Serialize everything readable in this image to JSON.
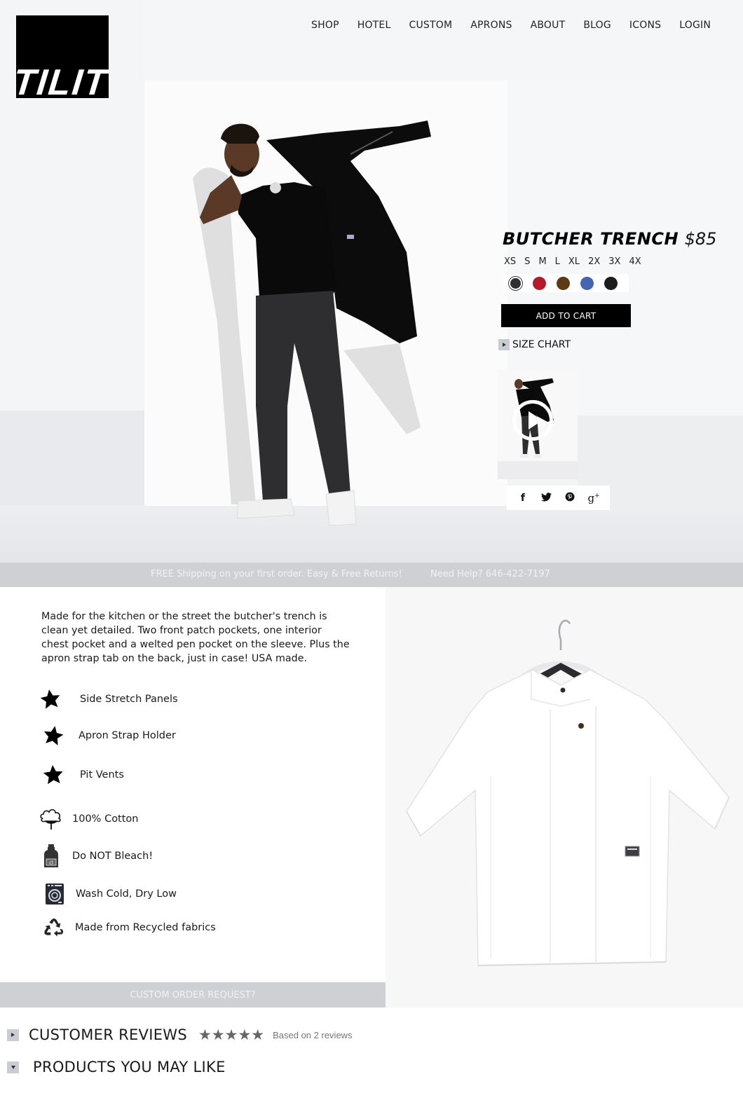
{
  "brand": {
    "logo_text": "TILIT"
  },
  "nav": {
    "items": [
      {
        "label": "SHOP"
      },
      {
        "label": "HOTEL"
      },
      {
        "label": "CUSTOM"
      },
      {
        "label": "APRONS"
      },
      {
        "label": "ABOUT"
      },
      {
        "label": "BLOG"
      },
      {
        "label": "ICONS"
      },
      {
        "label": "LOGIN"
      }
    ]
  },
  "product": {
    "name": "BUTCHER TRENCH",
    "price": "$85",
    "sizes": [
      "XS",
      "S",
      "M",
      "L",
      "XL",
      "2X",
      "3X",
      "4X"
    ],
    "colors": [
      {
        "name": "charcoal",
        "hex": "#2e2f33",
        "selected": true
      },
      {
        "name": "red",
        "hex": "#b5192b",
        "selected": false
      },
      {
        "name": "brown",
        "hex": "#5e3a14",
        "selected": false
      },
      {
        "name": "blue",
        "hex": "#4466b0",
        "selected": false
      },
      {
        "name": "black",
        "hex": "#1d1d1f",
        "selected": false
      }
    ],
    "add_to_cart_label": "ADD TO CART",
    "size_chart_label": "SIZE CHART",
    "video_thumbnail": {
      "icon": "play-icon"
    },
    "share": [
      {
        "network": "facebook",
        "glyph": "f"
      },
      {
        "network": "twitter",
        "glyph": "🐦"
      },
      {
        "network": "pinterest",
        "glyph": "℗"
      },
      {
        "network": "google-plus",
        "glyph": "g+"
      }
    ]
  },
  "shipping_bar": {
    "promo": "FREE Shipping on your first order. Easy & Free Returns!",
    "help": "Need Help? 646-422-7197"
  },
  "details": {
    "description": "Made for the kitchen or the street the butcher's trench is clean yet detailed. Two front patch pockets, one interior chest pocket and a welted pen pocket on the sleeve. Plus the apron strap tab on the back, just in case! USA made.",
    "features": [
      {
        "icon": "star-icon",
        "label": "Side Stretch Panels"
      },
      {
        "icon": "star-icon",
        "label": "Apron Strap Holder"
      },
      {
        "icon": "star-icon",
        "label": "Pit Vents"
      },
      {
        "icon": "cotton-icon",
        "label": "100% Cotton"
      },
      {
        "icon": "bleach-bottle-icon",
        "label": "Do NOT Bleach!"
      },
      {
        "icon": "washing-machine-icon",
        "label": "Wash Cold, Dry Low"
      },
      {
        "icon": "recycle-icon",
        "label": "Made from Recycled fabrics"
      }
    ],
    "custom_order_label": "CUSTOM ORDER REQUEST?"
  },
  "reviews": {
    "title": "CUSTOMER REVIEWS",
    "rating": 5,
    "rating_max": 5,
    "summary": "Based on 2 reviews"
  },
  "related": {
    "title": "PRODUCTS YOU MAY LIKE"
  }
}
